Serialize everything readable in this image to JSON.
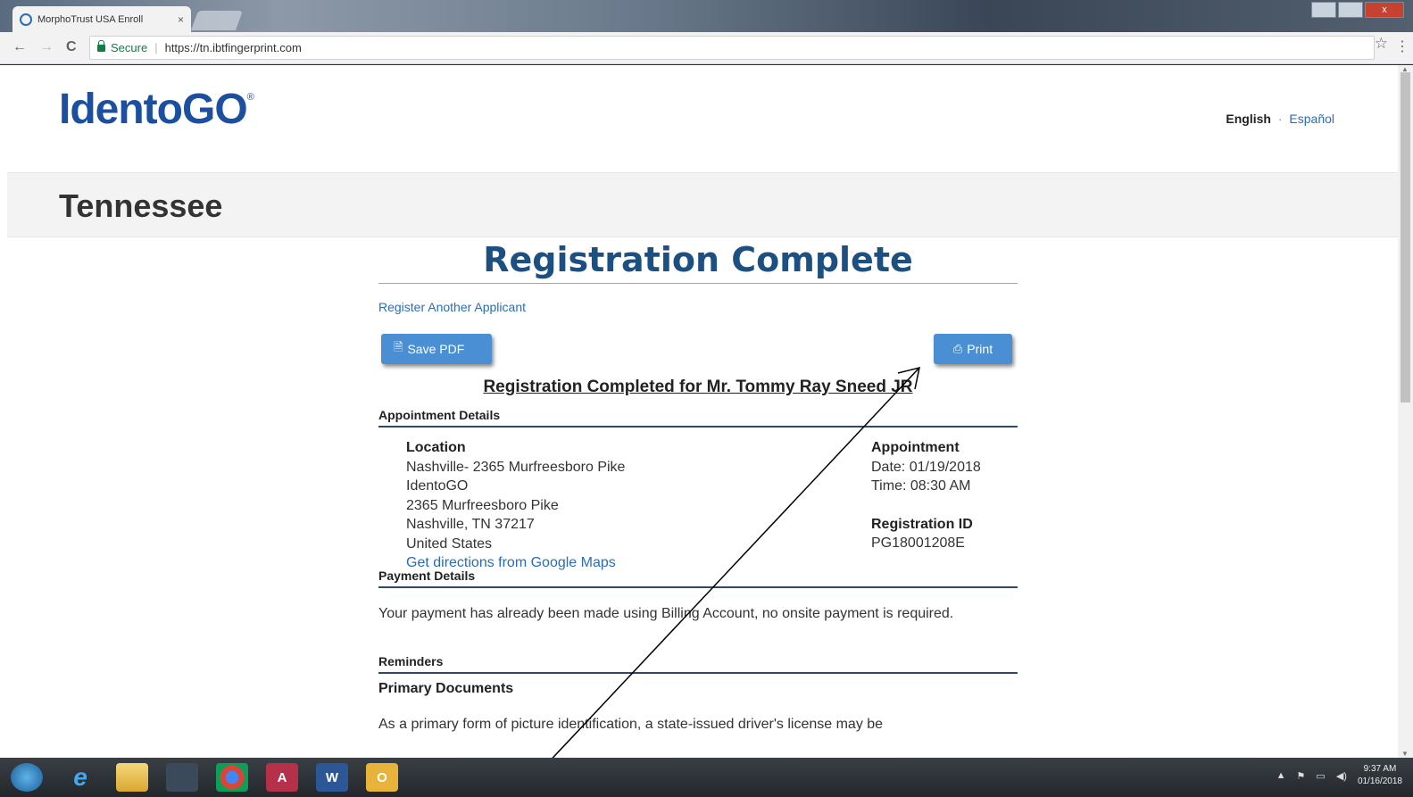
{
  "browser": {
    "tab_title": "MorphoTrust USA Enroll",
    "tab_close": "×",
    "window_close": "x",
    "secure_label": "Secure",
    "url": "https://tn.ibtfingerprint.com",
    "back": "←",
    "forward": "→",
    "reload": "C",
    "star": "☆",
    "menu": "⋮"
  },
  "header": {
    "logo_text": "IdentoGO",
    "logo_mark": "®",
    "lang_english": "English",
    "lang_separator": "·",
    "lang_spanish": "Español",
    "state": "Tennessee"
  },
  "main": {
    "title": "Registration Complete",
    "register_another": "Register Another Applicant",
    "save_pdf": "Save PDF",
    "print": "Print",
    "completed_for": "Registration Completed for Mr. Tommy Ray Sneed JR",
    "appointment_details_heading": "Appointment Details",
    "location_heading": "Location",
    "location_lines": [
      "Nashville- 2365 Murfreesboro Pike",
      "IdentoGO",
      "2365 Murfreesboro Pike",
      "Nashville, TN 37217",
      "United States"
    ],
    "directions_link": "Get directions from Google Maps",
    "appointment_heading": "Appointment",
    "date": "Date: 01/19/2018",
    "time": "Time: 08:30 AM",
    "registration_id_heading": "Registration ID",
    "registration_id": "PG18001208E",
    "payment_heading": "Payment Details",
    "payment_text": "Your payment has already been made using Billing Account, no onsite payment is required.",
    "reminders_heading": "Reminders",
    "primary_documents_heading": "Primary Documents",
    "primary_documents_text": "As a primary form of picture identification, a state-issued driver's license may be"
  },
  "taskbar": {
    "clock_time": "9:37 AM",
    "clock_date": "01/16/2018"
  },
  "colors": {
    "brand_blue": "#1c4fa0",
    "title_blue": "#1c4f82",
    "button_blue": "#4a8fd3",
    "link_blue": "#2a6db5",
    "secure_green": "#0b8043"
  }
}
